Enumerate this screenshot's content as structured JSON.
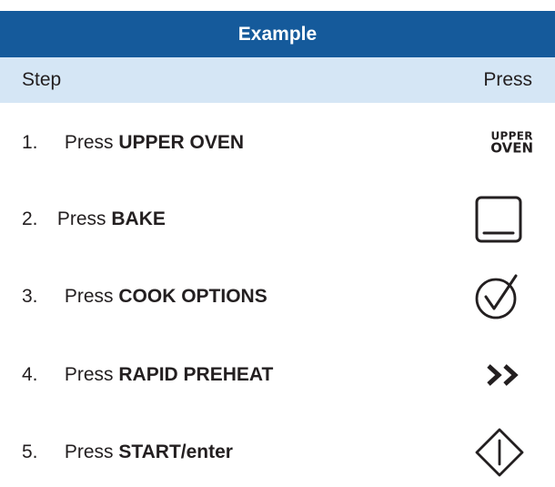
{
  "title": "Example",
  "columns": {
    "step": "Step",
    "press": "Press"
  },
  "steps": [
    {
      "number": "1.",
      "prefix": "Press",
      "action": "UPPER OVEN",
      "icon": "upper-oven-label",
      "icon_text_line1": "UPPER",
      "icon_text_line2": "OVEN"
    },
    {
      "number": "2.",
      "prefix": "Press",
      "action": "BAKE",
      "icon": "bake-icon"
    },
    {
      "number": "3.",
      "prefix": "Press",
      "action": "COOK OPTIONS",
      "icon": "check-circle-icon"
    },
    {
      "number": "4.",
      "prefix": "Press",
      "action": "RAPID PREHEAT",
      "icon": "double-chevron-icon"
    },
    {
      "number": "5.",
      "prefix": "Press",
      "action": "START/enter",
      "icon": "start-diamond-icon"
    }
  ],
  "colors": {
    "title_bg": "#155a9b",
    "header_bg": "#d5e6f5",
    "text": "#231f20"
  }
}
